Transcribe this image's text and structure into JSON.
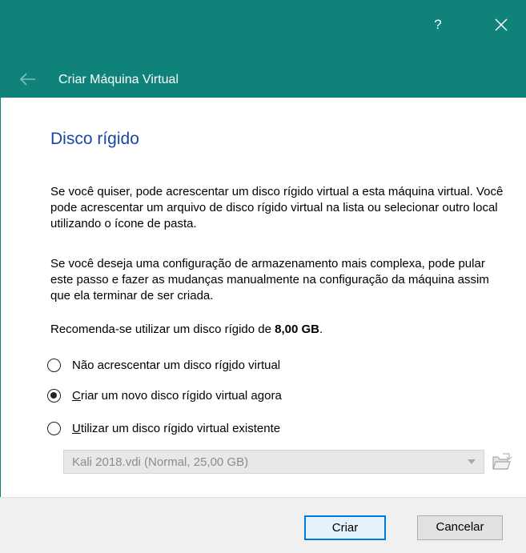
{
  "window": {
    "help_label": "?",
    "wizard_title": "Criar Máquina Virtual"
  },
  "page": {
    "title": "Disco rígido",
    "paragraph1": "Se você quiser, pode acrescentar um disco rígido virtual a esta máquina virtual. Você pode acrescentar um arquivo de disco rígido virtual na lista ou selecionar outro local utilizando o ícone de pasta.",
    "paragraph2": "Se você deseja uma configuração de armazenamento mais complexa, pode pular este passo e fazer as mudanças manualmente na configuração da máquina assim que ela terminar de ser criada.",
    "recommend_prefix": "Recomenda-se utilizar um disco rígido de ",
    "recommend_size": "8,00 GB",
    "recommend_suffix": "."
  },
  "options": {
    "no_disk": {
      "label_a": "Não acrescentar um disco ríg",
      "label_u": "i",
      "label_b": "do virtual",
      "selected": false
    },
    "create_new": {
      "label_u": "C",
      "label_b": "riar um novo disco rígido virtual agora",
      "selected": true
    },
    "use_existing": {
      "label_u": "U",
      "label_b": "tilizar um disco rígido virtual existente",
      "selected": false
    }
  },
  "existing_disk": {
    "value": "Kali 2018.vdi (Normal, 25,00 GB)",
    "enabled": false
  },
  "buttons": {
    "create": "Criar",
    "cancel": "Cancelar"
  },
  "icons": {
    "help": "help-icon",
    "close": "close-icon",
    "back": "back-arrow-icon",
    "folder": "folder-open-icon",
    "dropdown": "chevron-down-icon"
  },
  "colors": {
    "header_bg": "#0f8379",
    "title_blue": "#1a44a6",
    "focus_border": "#0078d7"
  }
}
